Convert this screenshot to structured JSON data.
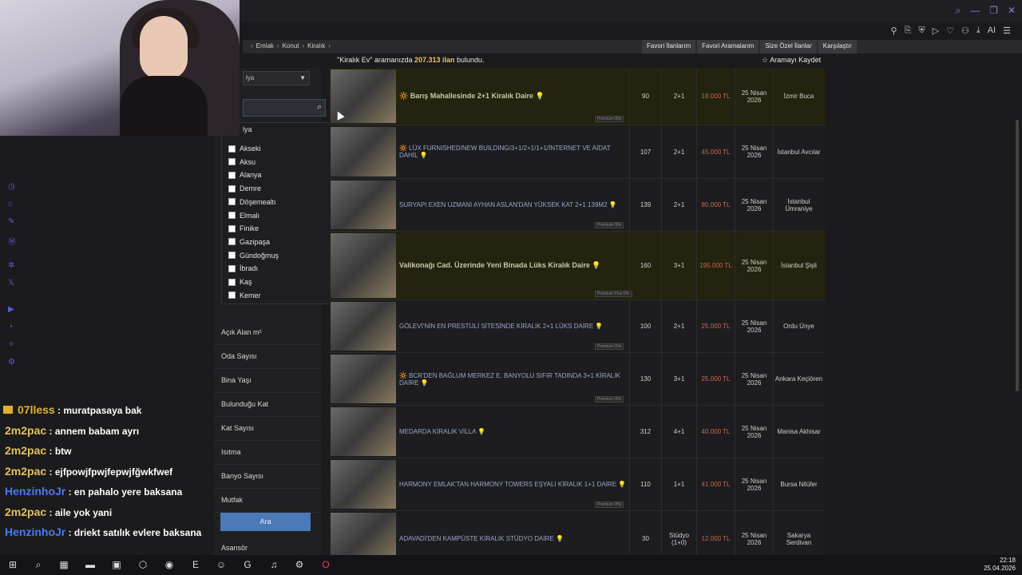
{
  "breadcrumb": [
    "Emlak",
    "Konut",
    "Kiralık"
  ],
  "top_links": [
    "Favori İlanlarım",
    "Favori Aramalarım",
    "Size Özel İlanlar",
    "Karşılaştır"
  ],
  "result": {
    "query": "\"Kiralık Ev\"",
    "prefix": "aramanızda",
    "count": "207.313 ilan",
    "suffix": "bulundu."
  },
  "save_search": "☆ Aramayı Kaydet",
  "city_select": "lya",
  "dropdown": {
    "header": "lya",
    "items": [
      "Akseki",
      "Aksu",
      "Alanya",
      "Demre",
      "Döşemealtı",
      "Elmalı",
      "Finike",
      "Gazipaşa",
      "Gündoğmuş",
      "İbradı",
      "Kaş",
      "Kemer"
    ]
  },
  "filters": [
    "Açık Alan m²",
    "Oda Sayısı",
    "Bina Yaşı",
    "Bulunduğu Kat",
    "Kat Sayısı",
    "Isıtma",
    "Banyo Sayısı",
    "Mutfak"
  ],
  "search_button": "Ara",
  "below_button": "Asansör",
  "listings": [
    {
      "title": "🔆 Barış Mahallesinde 2+1 Kiralık Daire 💡",
      "bold": true,
      "badge": "Premium Ofis",
      "m2": "90",
      "rooms": "2+1",
      "price": "18.000 TL",
      "date": "25 Nisan 2026",
      "loc": "İzmir Buca"
    },
    {
      "title": "🔆 LÜX FURNISHED/NEW BUILDING/3+1/2+1/1+1/İNTERNET VE AİDAT DAHİL 💡",
      "bold": false,
      "badge": "",
      "m2": "107",
      "rooms": "2+1",
      "price": "45.000 TL",
      "date": "25 Nisan 2026",
      "loc": "İstanbul Avcılar"
    },
    {
      "title": "SURYAPI EXEN UZMANI AYHAN ASLAN'DAN YÜKSEK KAT 2+1 139M2 💡",
      "bold": false,
      "badge": "Premium Ofis",
      "m2": "139",
      "rooms": "2+1",
      "price": "80.000 TL",
      "date": "25 Nisan 2026",
      "loc": "İstanbul Ümraniye"
    },
    {
      "title": "Valikonağı Cad. Üzerinde Yeni Binada Lüks Kiralık Daire 💡",
      "bold": true,
      "badge": "Premium Plus Ofis",
      "m2": "160",
      "rooms": "3+1",
      "price": "195.000 TL",
      "date": "25 Nisan 2026",
      "loc": "İstanbul Şişli"
    },
    {
      "title": "GÖLEVİ'NİN EN PRESTİJLİ SİTESİNDE KİRALIK 2+1 LÜKS DAİRE 💡",
      "bold": false,
      "badge": "Premium Ofis",
      "m2": "100",
      "rooms": "2+1",
      "price": "25.000 TL",
      "date": "25 Nisan 2026",
      "loc": "Ordu Ünye"
    },
    {
      "title": "🔆 BCR'DEN BAĞLUM MERKEZ E. BANYOLU SIFIR TADINDA 3+1 KİRALIK DAİRE 💡",
      "bold": false,
      "badge": "Premium Ofis",
      "m2": "130",
      "rooms": "3+1",
      "price": "25.000 TL",
      "date": "25 Nisan 2026",
      "loc": "Ankara Keçiören"
    },
    {
      "title": "MEDARDA KİRALIK VİLLA 💡",
      "bold": false,
      "badge": "",
      "m2": "312",
      "rooms": "4+1",
      "price": "40.000 TL",
      "date": "25 Nisan 2026",
      "loc": "Manisa Akhisar"
    },
    {
      "title": "HARMONY EMLAK'TAN HARMONY TOWERS EŞYALI KİRALIK 1+1 DAİRE 💡",
      "bold": false,
      "badge": "Premium Ofis",
      "m2": "110",
      "rooms": "1+1",
      "price": "41.000 TL",
      "date": "25 Nisan 2026",
      "loc": "Bursa Nilüfer"
    },
    {
      "title": "ADAVADİ'DEN KAMPÜSTE KİRALIK STÜDYO DAİRE 💡",
      "bold": false,
      "badge": "",
      "m2": "30",
      "rooms": "Stüdyo (1+0)",
      "price": "12.000 TL",
      "date": "25 Nisan 2026",
      "loc": "Sakarya Serdivan"
    }
  ],
  "chat": [
    {
      "user": "07lless",
      "color": "#e0b030",
      "msg": "muratpasaya bak"
    },
    {
      "user": "2m2pac",
      "color": "#e0c060",
      "msg": "annem babam ayrı"
    },
    {
      "user": "2m2pac",
      "color": "#e0c060",
      "msg": "btw"
    },
    {
      "user": "2m2pac",
      "color": "#e0c060",
      "msg": "ejfpowjfpwjfepwjfğwkfwef"
    },
    {
      "user": "HenzinhoJr",
      "color": "#4a7af0",
      "msg": "en pahalo yere baksana"
    },
    {
      "user": "2m2pac",
      "color": "#e0c060",
      "msg": "aile yok yani"
    },
    {
      "user": "HenzinhoJr",
      "color": "#4a7af0",
      "msg": "driekt satılık evlere baksana"
    }
  ],
  "toolbar": {
    "ai_label": "AI"
  },
  "clock": {
    "time": "22:18",
    "date": "25.04.2026"
  }
}
